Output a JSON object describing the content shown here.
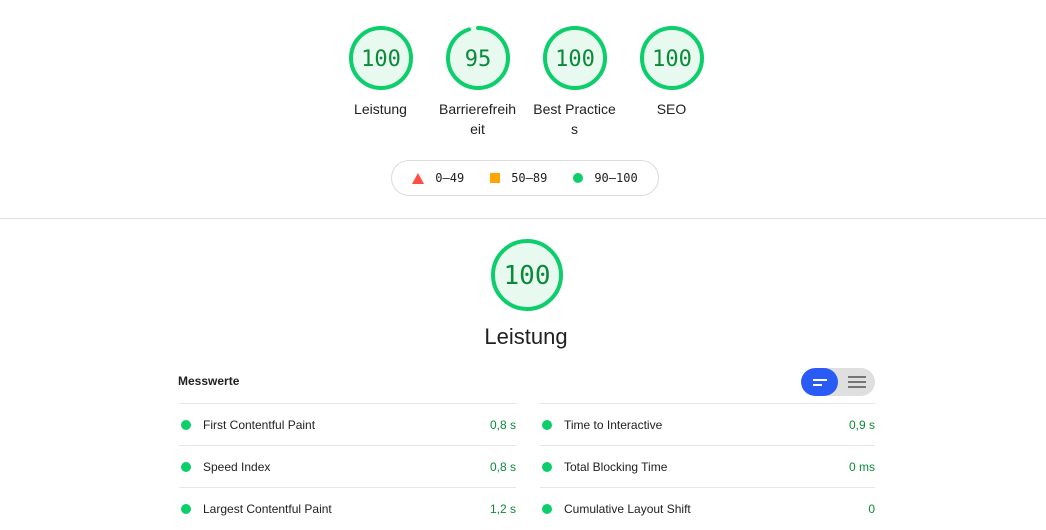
{
  "gauges": [
    {
      "score": 100,
      "display": "100",
      "label": "Leistung"
    },
    {
      "score": 95,
      "display": "95",
      "label": "Barrierefreiheit"
    },
    {
      "score": 100,
      "display": "100",
      "label": "Best Practices"
    },
    {
      "score": 100,
      "display": "100",
      "label": "SEO"
    }
  ],
  "legend": {
    "fail": "0–49",
    "average": "50–89",
    "pass": "90–100"
  },
  "category": {
    "score": 100,
    "display": "100",
    "title": "Leistung"
  },
  "metrics": {
    "header": "Messwerte",
    "left": [
      {
        "title": "First Contentful Paint",
        "value": "0,8 s"
      },
      {
        "title": "Speed Index",
        "value": "0,8 s"
      },
      {
        "title": "Largest Contentful Paint",
        "value": "1,2 s"
      }
    ],
    "right": [
      {
        "title": "Time to Interactive",
        "value": "0,9 s"
      },
      {
        "title": "Total Blocking Time",
        "value": "0 ms"
      },
      {
        "title": "Cumulative Layout Shift",
        "value": "0"
      }
    ]
  },
  "colors": {
    "pass": "#0cce6b",
    "pass_text": "#0a8a3a",
    "pass_fill": "#e8f9ef",
    "average": "#ffa400",
    "fail": "#ff4e42",
    "toggle_active": "#2a5bf5"
  }
}
